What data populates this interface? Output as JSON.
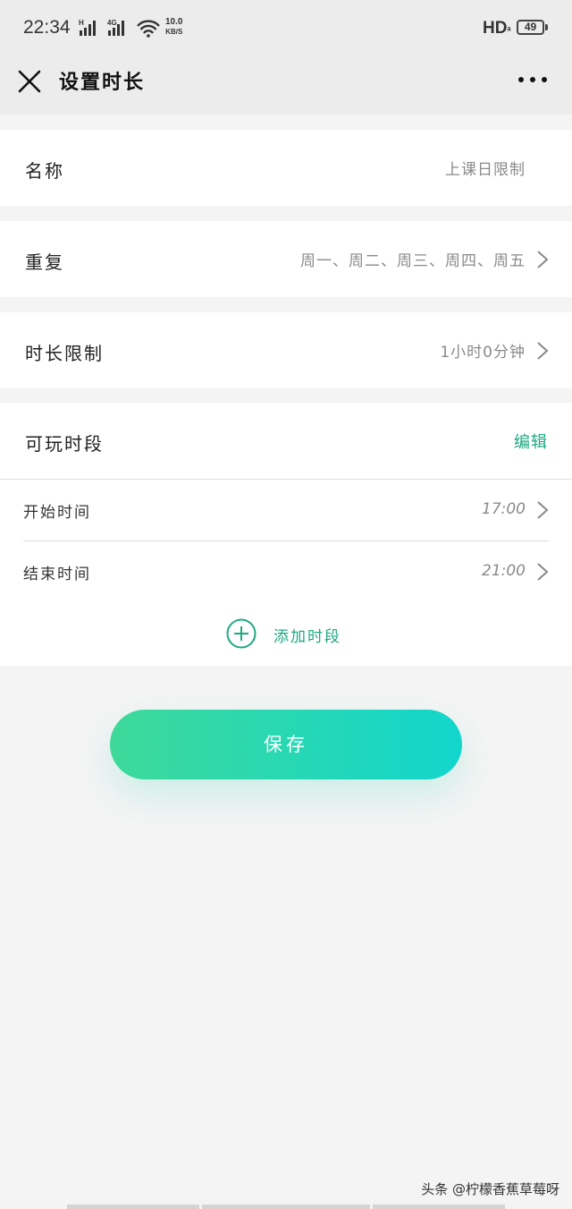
{
  "status_bar": {
    "time": "22:34",
    "network_speed_value": "10.0",
    "network_speed_unit": "KB/S",
    "hd_label": "HD",
    "battery": "49"
  },
  "header": {
    "title": "设置时长"
  },
  "settings": {
    "name_label": "名称",
    "name_value": "上课日限制",
    "repeat_label": "重复",
    "repeat_value": "周一、周二、周三、周四、周五",
    "limit_label": "时长限制",
    "limit_value": "1小时0分钟",
    "playable_label": "可玩时段",
    "edit_label": "编辑",
    "start_label": "开始时间",
    "start_value": "17:00",
    "end_label": "结束时间",
    "end_value": "21:00",
    "add_label": "添加时段"
  },
  "save_label": "保存",
  "watermark": "头条 @柠檬香蕉草莓呀",
  "colors": {
    "accent": "#1fa882",
    "button_start": "#3ed99a",
    "button_end": "#12d6cc",
    "page_bg": "#f4f4f4"
  },
  "icons": [
    "close-icon",
    "more-icon",
    "chevron-right-icon",
    "add-circle-icon",
    "signal-icon",
    "wifi-icon"
  ]
}
